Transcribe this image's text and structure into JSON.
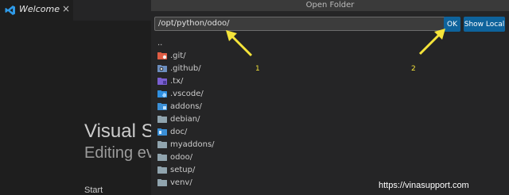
{
  "editor": {
    "tab_label": "Welcome",
    "tab_close": "×",
    "welcome_title": "Visual S",
    "welcome_subtitle": "Editing ev",
    "start_label": "Start"
  },
  "dialog": {
    "title": "Open Folder",
    "path_value": "/opt/python/odoo/",
    "ok_label": "OK",
    "show_local_label": "Show Local"
  },
  "files": [
    {
      "name": "..",
      "icon": "none"
    },
    {
      "name": ".git/",
      "icon": "git-folder-icon",
      "color": "#e05d44"
    },
    {
      "name": ".github/",
      "icon": "github-folder-icon",
      "color": "#6c8ebf"
    },
    {
      "name": ".tx/",
      "icon": "tx-folder-icon",
      "color": "#7a5fd1"
    },
    {
      "name": ".vscode/",
      "icon": "vscode-folder-icon",
      "color": "#2f8fe0"
    },
    {
      "name": "addons/",
      "icon": "addons-folder-icon",
      "color": "#3b8fd6"
    },
    {
      "name": "debian/",
      "icon": "folder-icon",
      "color": "#90a4ae"
    },
    {
      "name": "doc/",
      "icon": "doc-folder-icon",
      "color": "#3b8fd6"
    },
    {
      "name": "myaddons/",
      "icon": "folder-icon",
      "color": "#90a4ae"
    },
    {
      "name": "odoo/",
      "icon": "folder-icon",
      "color": "#90a4ae"
    },
    {
      "name": "setup/",
      "icon": "folder-icon",
      "color": "#90a4ae"
    },
    {
      "name": "venv/",
      "icon": "folder-icon",
      "color": "#90a4ae"
    }
  ],
  "annotations": {
    "label_1": "1",
    "label_2": "2",
    "color": "#f5e43a"
  },
  "watermark": "https://vinasupport.com"
}
